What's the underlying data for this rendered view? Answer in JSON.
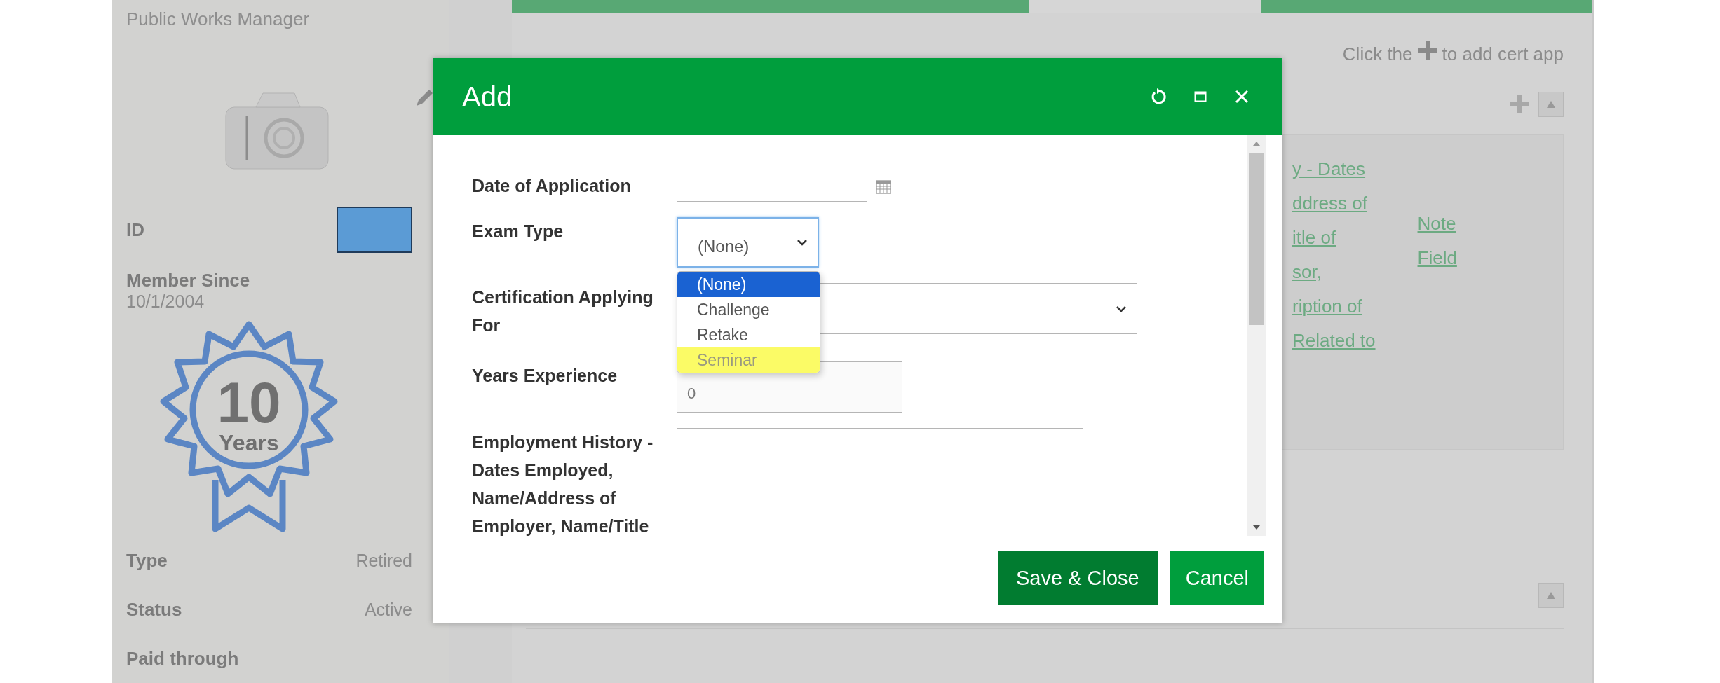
{
  "profile": {
    "job_title": "Public Works Manager",
    "id_label": "ID",
    "member_since": {
      "label": "Member Since",
      "value": "10/1/2004"
    },
    "badge": {
      "number": "10",
      "caption": "Years"
    },
    "details": [
      {
        "label": "Type",
        "value": "Retired"
      },
      {
        "label": "Status",
        "value": "Active"
      },
      {
        "label": "Paid through"
      }
    ]
  },
  "background": {
    "hint": {
      "before": "Click the",
      "after": "to add cert app"
    },
    "column_text": [
      "y - Dates",
      "ddress of",
      "itle of",
      "sor,",
      "ription of",
      "Related to"
    ],
    "note_link": "Note Field"
  },
  "modal": {
    "title": "Add",
    "fields": [
      {
        "kind": "date",
        "label": "Date of Application"
      },
      {
        "kind": "select",
        "label": "Exam Type",
        "value": "(None)",
        "expanded": true,
        "options": [
          {
            "label": "(None)",
            "selected": true,
            "highlighted": false
          },
          {
            "label": "Challenge",
            "selected": false,
            "highlighted": false
          },
          {
            "label": "Retake",
            "selected": false,
            "highlighted": false
          },
          {
            "label": "Seminar",
            "selected": false,
            "highlighted": true
          }
        ]
      },
      {
        "kind": "select",
        "label": "Certification Applying For",
        "expanded": false
      },
      {
        "kind": "number",
        "label": "Years Experience",
        "value": "0"
      },
      {
        "kind": "textarea",
        "label": "Employment History - Dates Employed, Name/Address of Employer, Name/Title"
      }
    ],
    "buttons": [
      {
        "label": "Save & Close",
        "primary": true
      },
      {
        "label": "Cancel",
        "primary": false
      }
    ]
  }
}
